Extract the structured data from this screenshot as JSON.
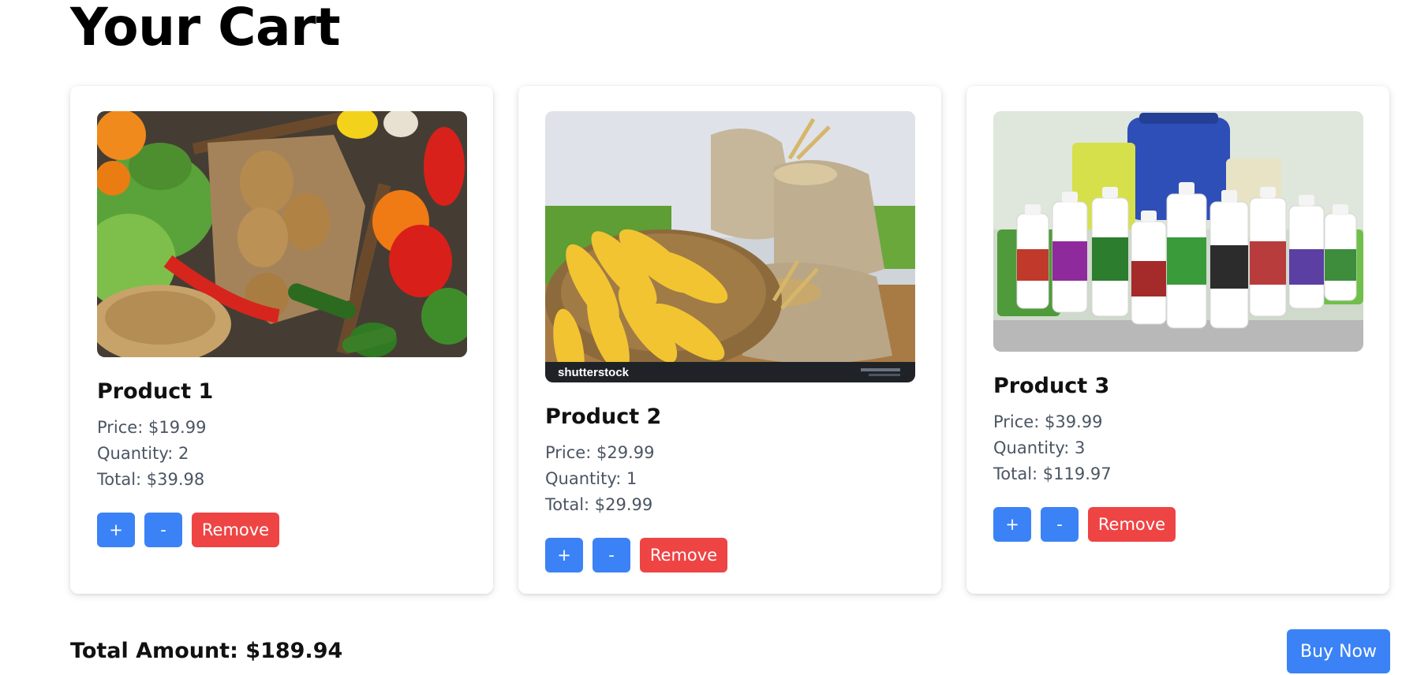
{
  "page": {
    "title": "Your Cart"
  },
  "cart": {
    "items": [
      {
        "name": "Product 1",
        "image_icon": "vegetables-image",
        "price": "Price: $19.99",
        "quantity": "Quantity: 2",
        "total": "Total: $39.98",
        "increment_label": "+",
        "decrement_label": "-",
        "remove_label": "Remove"
      },
      {
        "name": "Product 2",
        "image_icon": "grain-sacks-image",
        "watermark": "shutterstock",
        "price": "Price: $29.99",
        "quantity": "Quantity: 1",
        "total": "Total: $29.99",
        "increment_label": "+",
        "decrement_label": "-",
        "remove_label": "Remove"
      },
      {
        "name": "Product 3",
        "image_icon": "fertilizer-products-image",
        "price": "Price: $39.99",
        "quantity": "Quantity: 3",
        "total": "Total: $119.97",
        "increment_label": "+",
        "decrement_label": "-",
        "remove_label": "Remove"
      }
    ]
  },
  "footer": {
    "total_amount": "Total Amount: $189.94",
    "buy_label": "Buy Now"
  },
  "colors": {
    "primary_button": "#3b82f6",
    "danger_button": "#ef4444",
    "detail_text": "#4b5563"
  }
}
